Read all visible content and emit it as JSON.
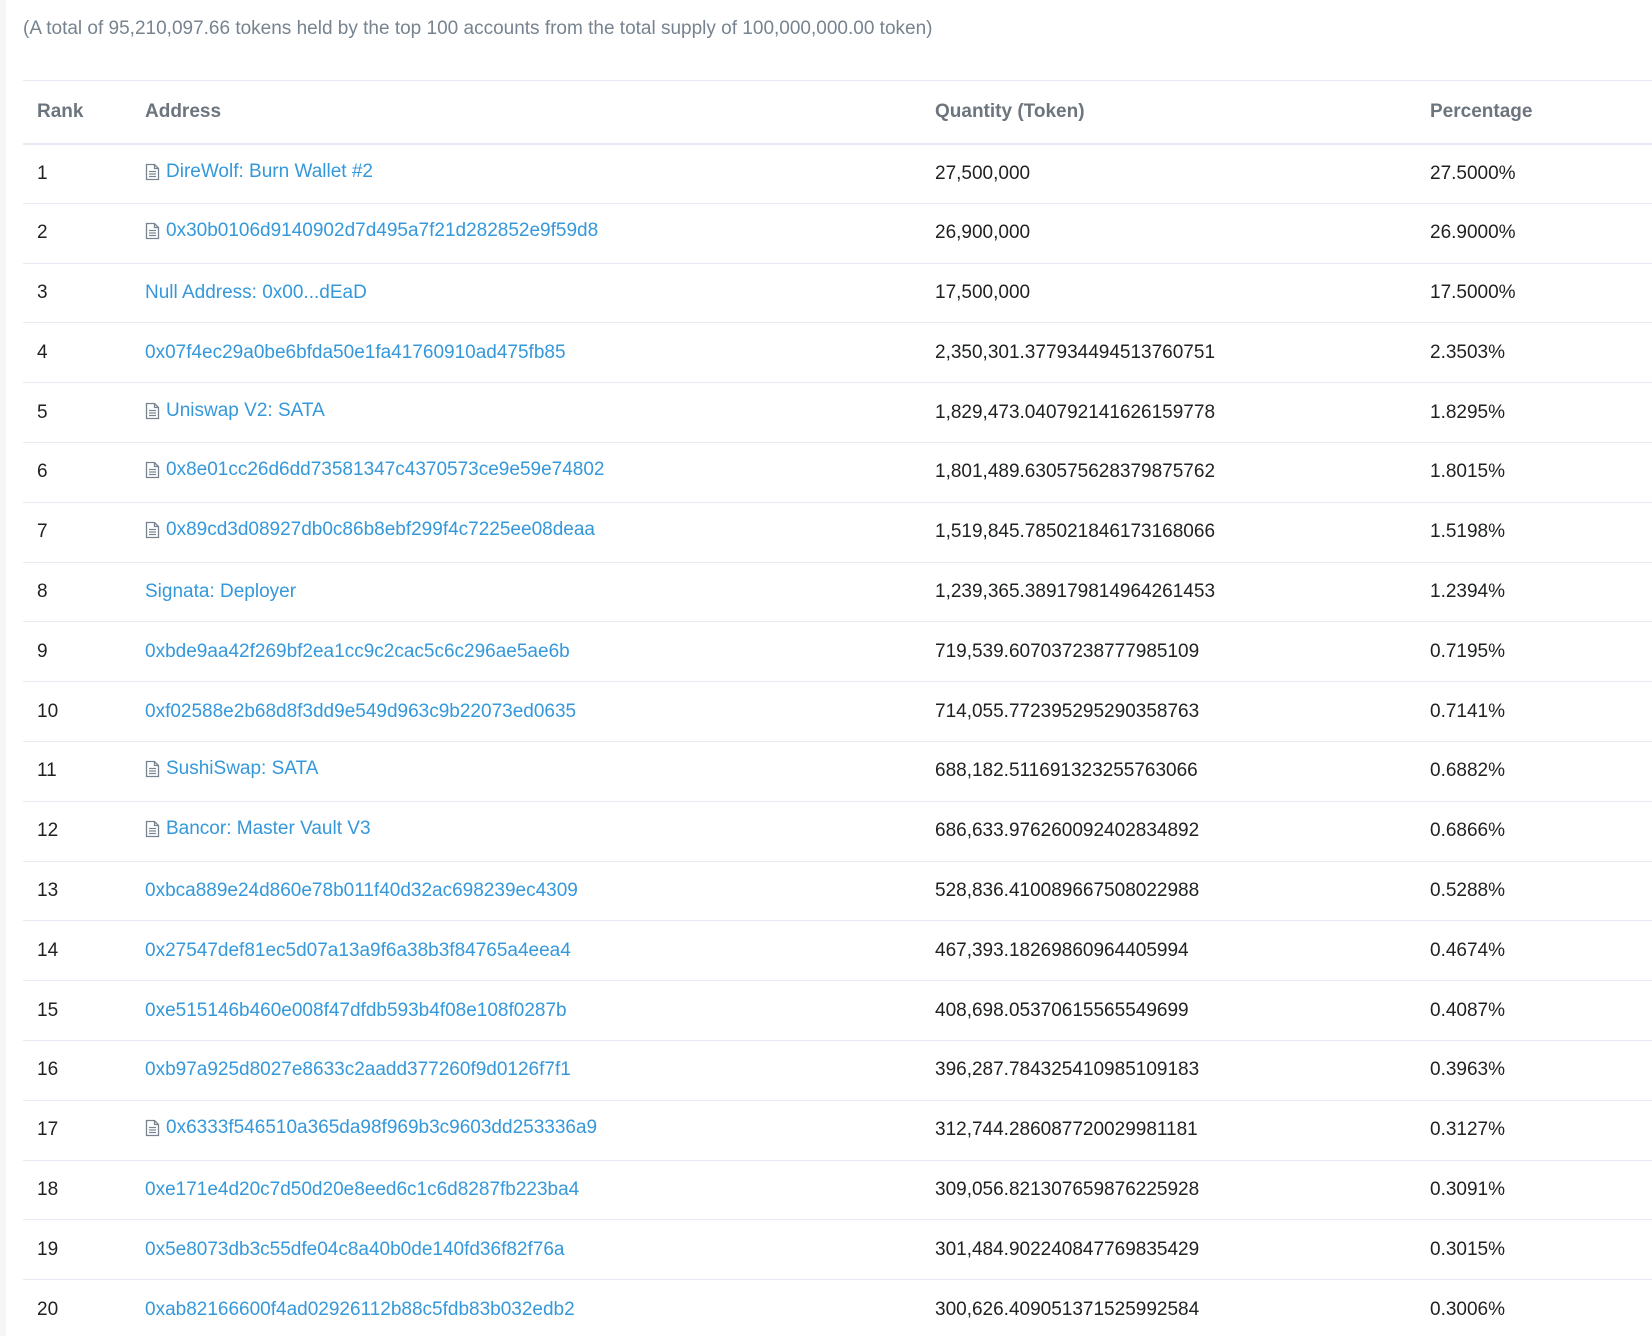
{
  "summary": "(A total of 95,210,097.66 tokens held by the top 100 accounts from the total supply of 100,000,000.00 token)",
  "columns": {
    "rank": "Rank",
    "address": "Address",
    "quantity": "Quantity (Token)",
    "percentage": "Percentage"
  },
  "colors": {
    "link": "#3498db",
    "header_text": "#6c757d",
    "summary_text": "#77838f",
    "row_border": "#e7eaf3"
  },
  "rows": [
    {
      "rank": "1",
      "address": "DireWolf: Burn Wallet #2",
      "contract": true,
      "quantity": "27,500,000",
      "percentage": "27.5000%"
    },
    {
      "rank": "2",
      "address": "0x30b0106d9140902d7d495a7f21d282852e9f59d8",
      "contract": true,
      "quantity": "26,900,000",
      "percentage": "26.9000%"
    },
    {
      "rank": "3",
      "address": "Null Address: 0x00...dEaD",
      "contract": false,
      "quantity": "17,500,000",
      "percentage": "17.5000%"
    },
    {
      "rank": "4",
      "address": "0x07f4ec29a0be6bfda50e1fa41760910ad475fb85",
      "contract": false,
      "quantity": "2,350,301.377934494513760751",
      "percentage": "2.3503%"
    },
    {
      "rank": "5",
      "address": "Uniswap V2: SATA",
      "contract": true,
      "quantity": "1,829,473.040792141626159778",
      "percentage": "1.8295%"
    },
    {
      "rank": "6",
      "address": "0x8e01cc26d6dd73581347c4370573ce9e59e74802",
      "contract": true,
      "quantity": "1,801,489.630575628379875762",
      "percentage": "1.8015%"
    },
    {
      "rank": "7",
      "address": "0x89cd3d08927db0c86b8ebf299f4c7225ee08deaa",
      "contract": true,
      "quantity": "1,519,845.785021846173168066",
      "percentage": "1.5198%"
    },
    {
      "rank": "8",
      "address": "Signata: Deployer",
      "contract": false,
      "quantity": "1,239,365.389179814964261453",
      "percentage": "1.2394%"
    },
    {
      "rank": "9",
      "address": "0xbde9aa42f269bf2ea1cc9c2cac5c6c296ae5ae6b",
      "contract": false,
      "quantity": "719,539.607037238777985109",
      "percentage": "0.7195%"
    },
    {
      "rank": "10",
      "address": "0xf02588e2b68d8f3dd9e549d963c9b22073ed0635",
      "contract": false,
      "quantity": "714,055.772395295290358763",
      "percentage": "0.7141%"
    },
    {
      "rank": "11",
      "address": "SushiSwap: SATA",
      "contract": true,
      "quantity": "688,182.511691323255763066",
      "percentage": "0.6882%"
    },
    {
      "rank": "12",
      "address": "Bancor: Master Vault V3",
      "contract": true,
      "quantity": "686,633.976260092402834892",
      "percentage": "0.6866%"
    },
    {
      "rank": "13",
      "address": "0xbca889e24d860e78b011f40d32ac698239ec4309",
      "contract": false,
      "quantity": "528,836.410089667508022988",
      "percentage": "0.5288%"
    },
    {
      "rank": "14",
      "address": "0x27547def81ec5d07a13a9f6a38b3f84765a4eea4",
      "contract": false,
      "quantity": "467,393.18269860964405994",
      "percentage": "0.4674%"
    },
    {
      "rank": "15",
      "address": "0xe515146b460e008f47dfdb593b4f08e108f0287b",
      "contract": false,
      "quantity": "408,698.05370615565549699",
      "percentage": "0.4087%"
    },
    {
      "rank": "16",
      "address": "0xb97a925d8027e8633c2aadd377260f9d0126f7f1",
      "contract": false,
      "quantity": "396,287.784325410985109183",
      "percentage": "0.3963%"
    },
    {
      "rank": "17",
      "address": "0x6333f546510a365da98f969b3c9603dd253336a9",
      "contract": true,
      "quantity": "312,744.286087720029981181",
      "percentage": "0.3127%"
    },
    {
      "rank": "18",
      "address": "0xe171e4d20c7d50d20e8eed6c1c6d8287fb223ba4",
      "contract": false,
      "quantity": "309,056.821307659876225928",
      "percentage": "0.3091%"
    },
    {
      "rank": "19",
      "address": "0x5e8073db3c55dfe04c8a40b0de140fd36f82f76a",
      "contract": false,
      "quantity": "301,484.902240847769835429",
      "percentage": "0.3015%"
    },
    {
      "rank": "20",
      "address": "0xab82166600f4ad02926112b88c5fdb83b032edb2",
      "contract": false,
      "quantity": "300,626.409051371525992584",
      "percentage": "0.3006%"
    }
  ]
}
